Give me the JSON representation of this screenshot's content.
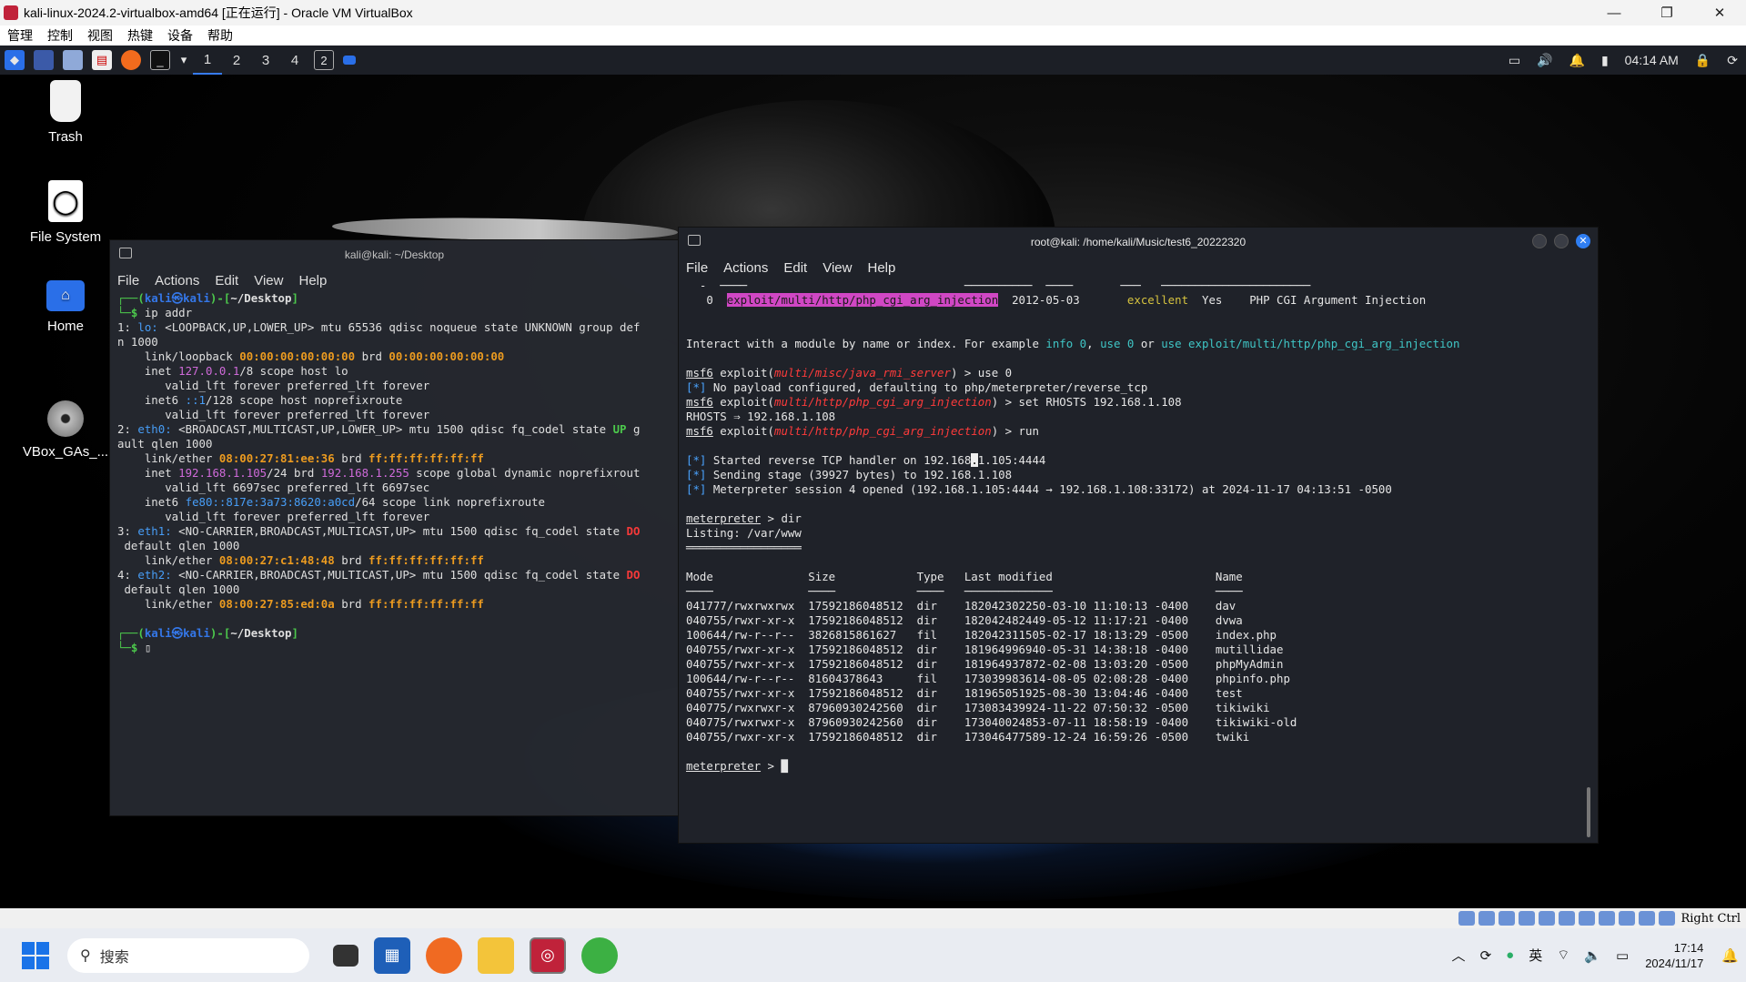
{
  "host": {
    "title": "kali-linux-2024.2-virtualbox-amd64 [正在运行] - Oracle VM VirtualBox",
    "menu": [
      "管理",
      "控制",
      "视图",
      "热键",
      "设备",
      "帮助"
    ],
    "controls": {
      "min": "—",
      "restore": "❐",
      "close": "✕"
    }
  },
  "panel": {
    "workspaces": [
      "1",
      "2",
      "3",
      "4"
    ],
    "clock": "04:14 AM"
  },
  "desktop": {
    "icons": [
      {
        "label": "Trash"
      },
      {
        "label": "File System"
      },
      {
        "label": "Home"
      },
      {
        "label": "VBox_GAs_..."
      }
    ]
  },
  "term1": {
    "title": "kali@kali: ~/Desktop",
    "menu": [
      "File",
      "Actions",
      "Edit",
      "View",
      "Help"
    ]
  },
  "term2": {
    "title": "root@kali: /home/kali/Music/test6_20222320",
    "menu": [
      "File",
      "Actions",
      "Edit",
      "View",
      "Help"
    ],
    "listing_headers": [
      "Mode",
      "Size",
      "Type",
      "Last modified",
      "Name"
    ],
    "listing": [
      [
        "041777/rwxrwxrwx",
        "17592186048512",
        "dir",
        "182042302250-03-10 11:10:13 -0400",
        "dav"
      ],
      [
        "040755/rwxr-xr-x",
        "17592186048512",
        "dir",
        "182042482449-05-12 11:17:21 -0400",
        "dvwa"
      ],
      [
        "100644/rw-r--r--",
        "3826815861627",
        "fil",
        "182042311505-02-17 18:13:29 -0500",
        "index.php"
      ],
      [
        "040755/rwxr-xr-x",
        "17592186048512",
        "dir",
        "181964996940-05-31 14:38:18 -0400",
        "mutillidae"
      ],
      [
        "040755/rwxr-xr-x",
        "17592186048512",
        "dir",
        "181964937872-02-08 13:03:20 -0500",
        "phpMyAdmin"
      ],
      [
        "100644/rw-r--r--",
        "81604378643",
        "fil",
        "173039983614-08-05 02:08:28 -0400",
        "phpinfo.php"
      ],
      [
        "040755/rwxr-xr-x",
        "17592186048512",
        "dir",
        "181965051925-08-30 13:04:46 -0400",
        "test"
      ],
      [
        "040775/rwxrwxr-x",
        "87960930242560",
        "dir",
        "173083439924-11-22 07:50:32 -0500",
        "tikiwiki"
      ],
      [
        "040775/rwxrwxr-x",
        "87960930242560",
        "dir",
        "173040024853-07-11 18:58:19 -0400",
        "tikiwiki-old"
      ],
      [
        "040755/rwxr-xr-x",
        "17592186048512",
        "dir",
        "173046477589-12-24 16:59:26 -0500",
        "twiki"
      ]
    ]
  },
  "vb_status": {
    "hostkey": "Right Ctrl"
  },
  "taskbar": {
    "search_placeholder": "搜索",
    "tray_lang": "英",
    "time": "17:14",
    "date": "2024/11/17"
  },
  "colors": {
    "kali_blue": "#367bf0",
    "orange": "#f4a021",
    "purple": "#d66ee0"
  }
}
